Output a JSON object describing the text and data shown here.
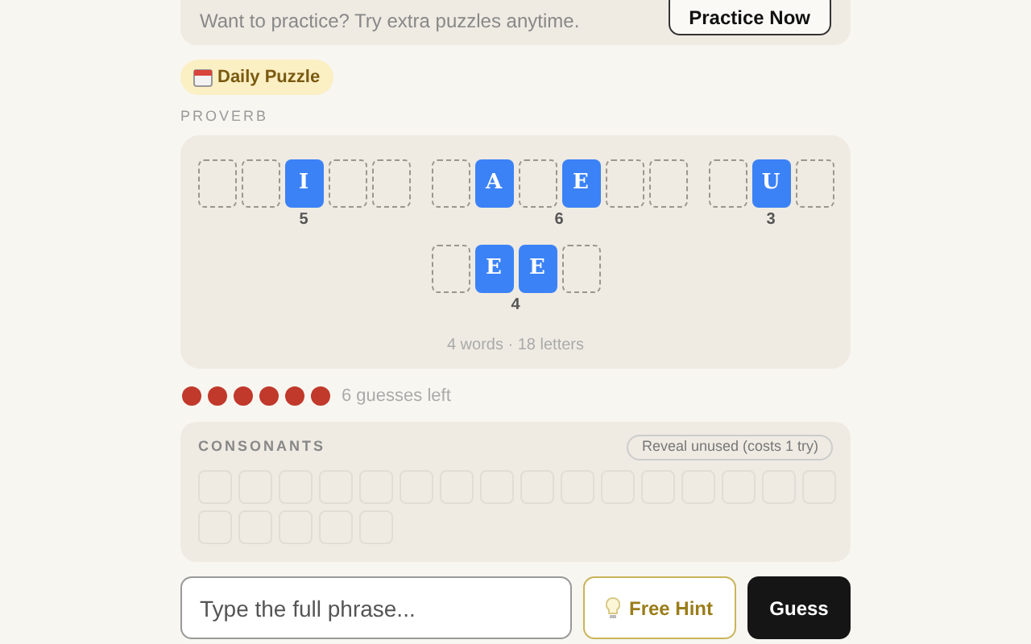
{
  "practice": {
    "text": "Want to practice? Try extra puzzles anytime.",
    "button": "Practice Now"
  },
  "badge": "Daily Puzzle",
  "category": "PROVERB",
  "words": [
    {
      "length": "5",
      "tiles": [
        {
          "revealed": false
        },
        {
          "revealed": false
        },
        {
          "revealed": true,
          "letter": "I"
        },
        {
          "revealed": false
        },
        {
          "revealed": false
        }
      ]
    },
    {
      "length": "6",
      "tiles": [
        {
          "revealed": false
        },
        {
          "revealed": true,
          "letter": "A"
        },
        {
          "revealed": false
        },
        {
          "revealed": true,
          "letter": "E"
        },
        {
          "revealed": false
        },
        {
          "revealed": false
        }
      ]
    },
    {
      "length": "3",
      "tiles": [
        {
          "revealed": false
        },
        {
          "revealed": true,
          "letter": "U"
        },
        {
          "revealed": false
        }
      ]
    },
    {
      "length": "4",
      "tiles": [
        {
          "revealed": false
        },
        {
          "revealed": true,
          "letter": "E"
        },
        {
          "revealed": true,
          "letter": "E"
        },
        {
          "revealed": false
        }
      ]
    }
  ],
  "summary": "4 words · 18 letters",
  "guesses": {
    "lives": [
      {
        "used": false
      },
      {
        "used": false
      },
      {
        "used": false
      },
      {
        "used": false
      },
      {
        "used": false
      },
      {
        "used": false
      }
    ],
    "label": "6 guesses left"
  },
  "consonants": {
    "title": "CONSONANTS",
    "reveal_button": "Reveal unused (costs 1 try)",
    "keys": [
      {
        "disabled": true
      },
      {
        "disabled": true
      },
      {
        "disabled": true
      },
      {
        "disabled": true
      },
      {
        "disabled": true
      },
      {
        "disabled": true
      },
      {
        "disabled": true
      },
      {
        "disabled": true
      },
      {
        "disabled": true
      },
      {
        "disabled": true
      },
      {
        "disabled": true
      },
      {
        "disabled": true
      },
      {
        "disabled": true
      },
      {
        "disabled": true
      },
      {
        "disabled": true
      },
      {
        "disabled": true
      },
      {
        "disabled": true
      },
      {
        "disabled": true
      },
      {
        "disabled": true
      },
      {
        "disabled": true
      },
      {
        "disabled": true
      }
    ]
  },
  "input": {
    "placeholder": "Type the full phrase..."
  },
  "hint_button": "Free Hint",
  "guess_button": "Guess"
}
